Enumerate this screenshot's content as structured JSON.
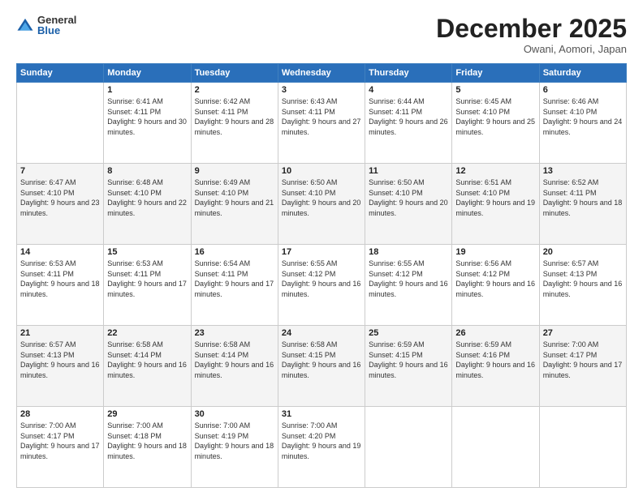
{
  "logo": {
    "general": "General",
    "blue": "Blue"
  },
  "header": {
    "month": "December 2025",
    "location": "Owani, Aomori, Japan"
  },
  "weekdays": [
    "Sunday",
    "Monday",
    "Tuesday",
    "Wednesday",
    "Thursday",
    "Friday",
    "Saturday"
  ],
  "weeks": [
    [
      {
        "day": "",
        "empty": true
      },
      {
        "day": "1",
        "sunrise": "6:41 AM",
        "sunset": "4:11 PM",
        "daylight": "9 hours and 30 minutes."
      },
      {
        "day": "2",
        "sunrise": "6:42 AM",
        "sunset": "4:11 PM",
        "daylight": "9 hours and 28 minutes."
      },
      {
        "day": "3",
        "sunrise": "6:43 AM",
        "sunset": "4:11 PM",
        "daylight": "9 hours and 27 minutes."
      },
      {
        "day": "4",
        "sunrise": "6:44 AM",
        "sunset": "4:11 PM",
        "daylight": "9 hours and 26 minutes."
      },
      {
        "day": "5",
        "sunrise": "6:45 AM",
        "sunset": "4:10 PM",
        "daylight": "9 hours and 25 minutes."
      },
      {
        "day": "6",
        "sunrise": "6:46 AM",
        "sunset": "4:10 PM",
        "daylight": "9 hours and 24 minutes."
      }
    ],
    [
      {
        "day": "7",
        "sunrise": "6:47 AM",
        "sunset": "4:10 PM",
        "daylight": "9 hours and 23 minutes."
      },
      {
        "day": "8",
        "sunrise": "6:48 AM",
        "sunset": "4:10 PM",
        "daylight": "9 hours and 22 minutes."
      },
      {
        "day": "9",
        "sunrise": "6:49 AM",
        "sunset": "4:10 PM",
        "daylight": "9 hours and 21 minutes."
      },
      {
        "day": "10",
        "sunrise": "6:50 AM",
        "sunset": "4:10 PM",
        "daylight": "9 hours and 20 minutes."
      },
      {
        "day": "11",
        "sunrise": "6:50 AM",
        "sunset": "4:10 PM",
        "daylight": "9 hours and 20 minutes."
      },
      {
        "day": "12",
        "sunrise": "6:51 AM",
        "sunset": "4:10 PM",
        "daylight": "9 hours and 19 minutes."
      },
      {
        "day": "13",
        "sunrise": "6:52 AM",
        "sunset": "4:11 PM",
        "daylight": "9 hours and 18 minutes."
      }
    ],
    [
      {
        "day": "14",
        "sunrise": "6:53 AM",
        "sunset": "4:11 PM",
        "daylight": "9 hours and 18 minutes."
      },
      {
        "day": "15",
        "sunrise": "6:53 AM",
        "sunset": "4:11 PM",
        "daylight": "9 hours and 17 minutes."
      },
      {
        "day": "16",
        "sunrise": "6:54 AM",
        "sunset": "4:11 PM",
        "daylight": "9 hours and 17 minutes."
      },
      {
        "day": "17",
        "sunrise": "6:55 AM",
        "sunset": "4:12 PM",
        "daylight": "9 hours and 16 minutes."
      },
      {
        "day": "18",
        "sunrise": "6:55 AM",
        "sunset": "4:12 PM",
        "daylight": "9 hours and 16 minutes."
      },
      {
        "day": "19",
        "sunrise": "6:56 AM",
        "sunset": "4:12 PM",
        "daylight": "9 hours and 16 minutes."
      },
      {
        "day": "20",
        "sunrise": "6:57 AM",
        "sunset": "4:13 PM",
        "daylight": "9 hours and 16 minutes."
      }
    ],
    [
      {
        "day": "21",
        "sunrise": "6:57 AM",
        "sunset": "4:13 PM",
        "daylight": "9 hours and 16 minutes."
      },
      {
        "day": "22",
        "sunrise": "6:58 AM",
        "sunset": "4:14 PM",
        "daylight": "9 hours and 16 minutes."
      },
      {
        "day": "23",
        "sunrise": "6:58 AM",
        "sunset": "4:14 PM",
        "daylight": "9 hours and 16 minutes."
      },
      {
        "day": "24",
        "sunrise": "6:58 AM",
        "sunset": "4:15 PM",
        "daylight": "9 hours and 16 minutes."
      },
      {
        "day": "25",
        "sunrise": "6:59 AM",
        "sunset": "4:15 PM",
        "daylight": "9 hours and 16 minutes."
      },
      {
        "day": "26",
        "sunrise": "6:59 AM",
        "sunset": "4:16 PM",
        "daylight": "9 hours and 16 minutes."
      },
      {
        "day": "27",
        "sunrise": "7:00 AM",
        "sunset": "4:17 PM",
        "daylight": "9 hours and 17 minutes."
      }
    ],
    [
      {
        "day": "28",
        "sunrise": "7:00 AM",
        "sunset": "4:17 PM",
        "daylight": "9 hours and 17 minutes."
      },
      {
        "day": "29",
        "sunrise": "7:00 AM",
        "sunset": "4:18 PM",
        "daylight": "9 hours and 18 minutes."
      },
      {
        "day": "30",
        "sunrise": "7:00 AM",
        "sunset": "4:19 PM",
        "daylight": "9 hours and 18 minutes."
      },
      {
        "day": "31",
        "sunrise": "7:00 AM",
        "sunset": "4:20 PM",
        "daylight": "9 hours and 19 minutes."
      },
      {
        "day": "",
        "empty": true
      },
      {
        "day": "",
        "empty": true
      },
      {
        "day": "",
        "empty": true
      }
    ]
  ]
}
